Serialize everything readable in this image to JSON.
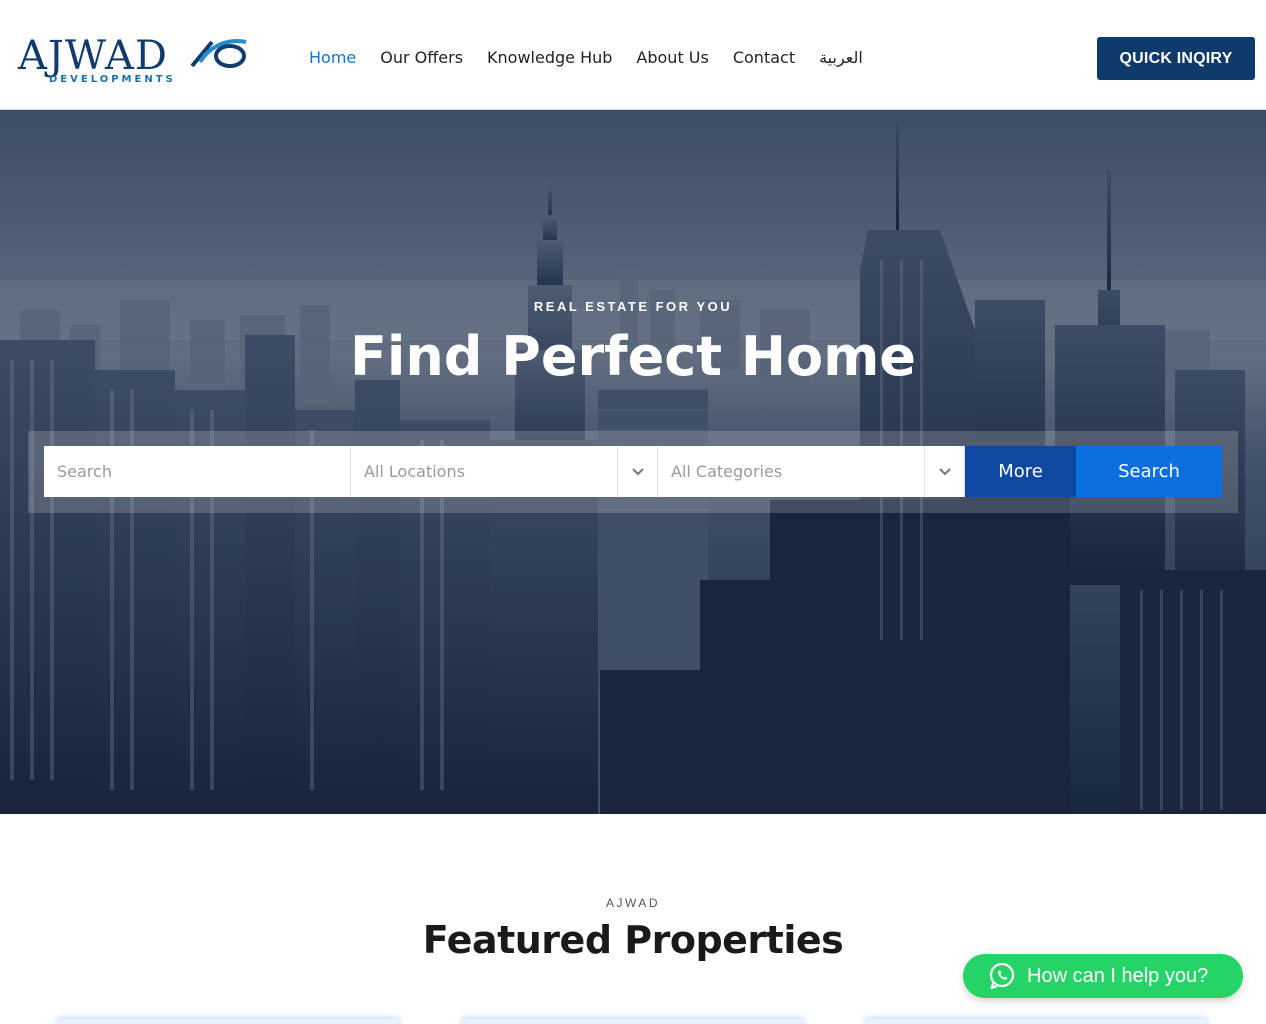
{
  "header": {
    "logo": {
      "word": "AJWAD",
      "sub": "DEVELOPMENTS"
    },
    "nav": [
      {
        "label": "Home",
        "active": true
      },
      {
        "label": "Our Offers",
        "active": false
      },
      {
        "label": "Knowledge Hub",
        "active": false
      },
      {
        "label": "About Us",
        "active": false
      },
      {
        "label": "Contact",
        "active": false
      },
      {
        "label": "العربية",
        "active": false
      }
    ],
    "cta_label": "QUICK INQIRY"
  },
  "hero": {
    "kicker": "REAL ESTATE FOR YOU",
    "title": "Find Perfect Home",
    "search": {
      "keyword_placeholder": "Search",
      "location_value": "All Locations",
      "category_value": "All Categories",
      "more_label": "More",
      "search_label": "Search"
    }
  },
  "featured": {
    "kicker": "AJWAD",
    "title": "Featured Properties"
  },
  "whatsapp": {
    "label": "How can I help you?"
  },
  "colors": {
    "brand_navy": "#0e3a6c",
    "nav_active": "#1672c9",
    "more_button": "#0e48a1",
    "search_button": "#0b6fe0",
    "whatsapp_green": "#25d366"
  }
}
